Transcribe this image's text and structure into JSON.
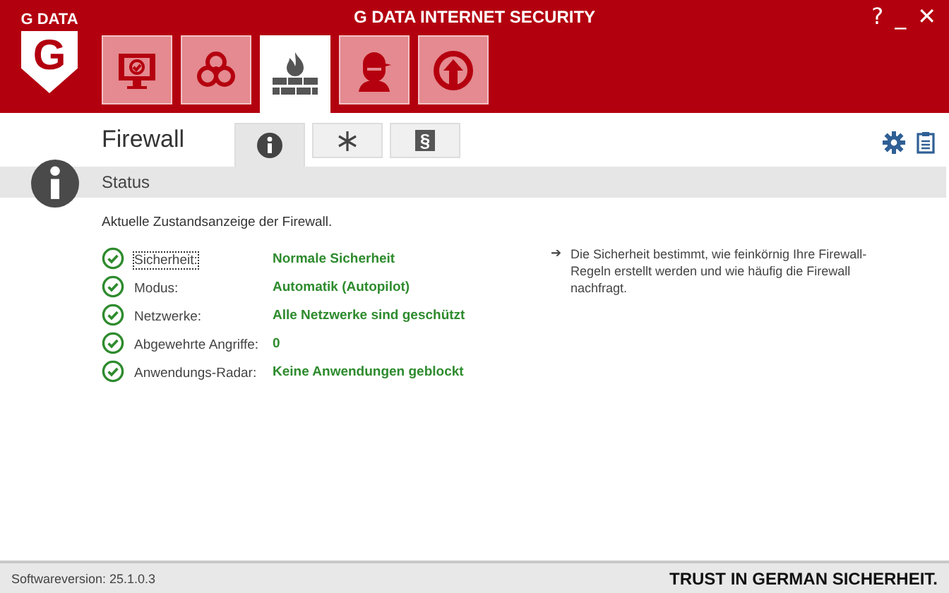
{
  "window": {
    "title": "G DATA INTERNET SECURITY",
    "buttons": [
      "?",
      "_",
      "✕"
    ]
  },
  "logo": {
    "text": "G DATA",
    "letter": "G"
  },
  "modules": [
    {
      "kind": "monitor",
      "selected": false
    },
    {
      "kind": "biohazard",
      "selected": false
    },
    {
      "kind": "firewall",
      "selected": true
    },
    {
      "kind": "person",
      "selected": false
    },
    {
      "kind": "update",
      "selected": false
    }
  ],
  "page_title": "Firewall",
  "subtabs": [
    {
      "kind": "info",
      "selected": true
    },
    {
      "kind": "snowflake",
      "selected": false
    },
    {
      "kind": "paragraph",
      "label": "§",
      "selected": false
    }
  ],
  "section": "Status",
  "intro": "Aktuelle Zustandsanzeige der Firewall.",
  "rows": [
    {
      "label": "Sicherheit:",
      "value": "Normale Sicherheit",
      "selected": true
    },
    {
      "label": "Modus:",
      "value": "Automatik (Autopilot)",
      "selected": false
    },
    {
      "label": "Netzwerke:",
      "value": "Alle Netzwerke sind geschützt",
      "selected": false
    },
    {
      "label": "Abgewehrte Angriffe:",
      "value": "0",
      "selected": false
    },
    {
      "label": "Anwendungs-Radar:",
      "value": "Keine Anwendungen geblockt",
      "selected": false
    }
  ],
  "hint": {
    "arrow": "➔",
    "text": "Die Sicherheit bestimmt, wie feinkörnig Ihre Firewall-Regeln erstellt werden und wie häufig die Firewall nachfragt."
  },
  "footer": {
    "version": "Softwareversion: 25.1.0.3",
    "slogan": "TRUST IN GERMAN SICHERHEIT."
  }
}
